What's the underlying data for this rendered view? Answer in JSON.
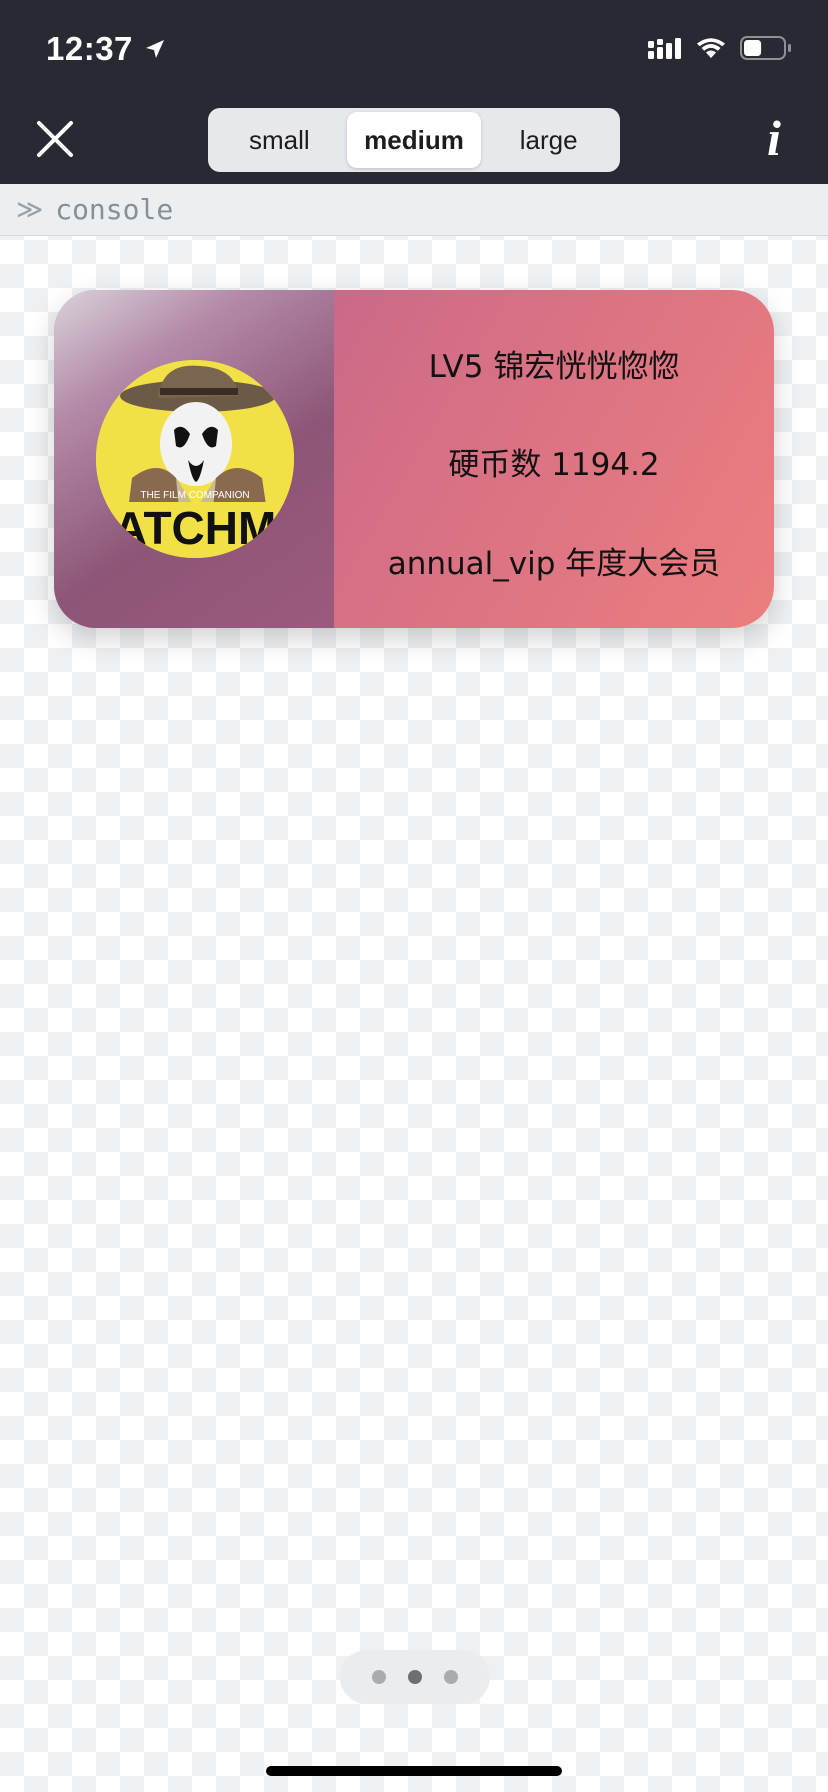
{
  "status_bar": {
    "time": "12:37",
    "icons": [
      "location-arrow-icon",
      "signal-icon",
      "wifi-icon",
      "battery-icon"
    ],
    "battery_level": 0.45
  },
  "toolbar": {
    "close_icon": "close-icon",
    "size_options": [
      "small",
      "medium",
      "large"
    ],
    "selected_size": "medium",
    "info_label": "i"
  },
  "console": {
    "prompt_icon": "double-chevron-icon",
    "label": "console"
  },
  "widget": {
    "avatar_icon": "avatar-image",
    "line1": "LV5 锦宏恍恍惚惚",
    "line2": "硬币数 1194.2",
    "line3": "annual_vip 年度大会员",
    "colors": {
      "gradient_start": "#b75d8b",
      "gradient_end": "#ec7e7e"
    }
  },
  "pager": {
    "page_count": 3,
    "active_page": 2
  }
}
